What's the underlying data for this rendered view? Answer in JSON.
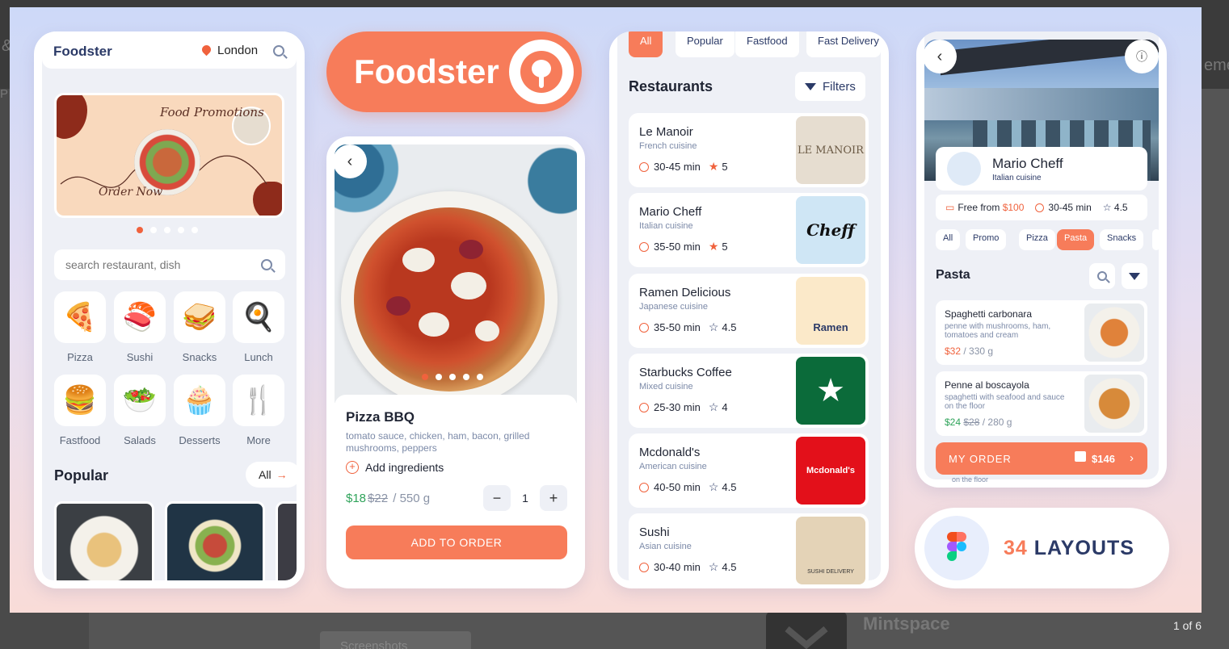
{
  "viewer": {
    "counter": "1 of 6"
  },
  "backdrop": {
    "title": "Mintspace",
    "button": "Screenshots",
    "frag_left": "&",
    "frag_left2": "P",
    "frag_right": "eme"
  },
  "brand": {
    "name": "Foodster",
    "accent": "#f77c5a"
  },
  "home": {
    "title": "Foodster",
    "location": "London",
    "banner_title": "Food Promotions",
    "banner_cta": "Order Now",
    "search_placeholder": "search restaurant, dish",
    "categories": [
      {
        "label": "Pizza",
        "icon": "pizza-icon",
        "glyph": "🍕"
      },
      {
        "label": "Sushi",
        "icon": "sushi-icon",
        "glyph": "🍣"
      },
      {
        "label": "Snacks",
        "icon": "snacks-icon",
        "glyph": "🥪"
      },
      {
        "label": "Lunch",
        "icon": "lunch-icon",
        "glyph": "🍳"
      },
      {
        "label": "Fastfood",
        "icon": "burger-icon",
        "glyph": "🍔"
      },
      {
        "label": "Salads",
        "icon": "salad-icon",
        "glyph": "🥗"
      },
      {
        "label": "Desserts",
        "icon": "cupcake-icon",
        "glyph": "🧁"
      },
      {
        "label": "More",
        "icon": "cutlery-icon",
        "glyph": "🍴"
      }
    ],
    "popular_title": "Popular",
    "popular_all": "All"
  },
  "detail": {
    "name": "Pizza BBQ",
    "description": "tomato sauce, chicken, ham, bacon, grilled mushrooms, peppers",
    "add_ingredients": "Add ingredients",
    "price": "$18",
    "old_price": "$22",
    "weight": "/ 550 g",
    "quantity": "1",
    "cta": "ADD TO ORDER"
  },
  "restaurants": {
    "tabs": [
      "All",
      "Popular",
      "Fastfood",
      "Fast Delivery"
    ],
    "title": "Restaurants",
    "filters": "Filters",
    "items": [
      {
        "name": "Le Manoir",
        "cuisine": "French cuisine",
        "time": "30-45 min",
        "rating": "5",
        "logo": "LE MANOIR",
        "logo_bg": "#e6ddd0",
        "logo_color": "#6b5a45",
        "star_filled": true
      },
      {
        "name": "Mario Cheff",
        "cuisine": "Italian cuisine",
        "time": "35-50 min",
        "rating": "5",
        "logo": "Cheff",
        "logo_bg": "#cfe6f5",
        "logo_color": "#111",
        "star_filled": true
      },
      {
        "name": "Ramen Delicious",
        "cuisine": "Japanese cuisine",
        "time": "35-50 min",
        "rating": "4.5",
        "logo": "Ramen",
        "logo_bg": "#fbe9c9",
        "logo_color": "#2b3a67",
        "star_filled": false
      },
      {
        "name": "Starbucks Coffee",
        "cuisine": "Mixed cuisine",
        "time": "25-30 min",
        "rating": "4",
        "logo": "★",
        "logo_bg": "#0b6b3a",
        "logo_color": "#fff",
        "star_filled": false
      },
      {
        "name": "Mcdonald's",
        "cuisine": "American cuisine",
        "time": "40-50 min",
        "rating": "4.5",
        "logo": "Mcdonald's",
        "logo_bg": "#e3101a",
        "logo_color": "#ffc72c",
        "star_filled": false
      },
      {
        "name": "Sushi",
        "cuisine": "Asian cuisine",
        "time": "30-40 min",
        "rating": "4.5",
        "logo": "SUSHI DELIVERY",
        "logo_bg": "#e4d3b7",
        "logo_color": "#333",
        "star_filled": false
      }
    ]
  },
  "menu": {
    "restaurant": "Mario Cheff",
    "cuisine": "Italian cuisine",
    "free_prefix": "Free from",
    "free_amount": "$100",
    "time": "30-45 min",
    "rating": "4.5",
    "tabs": [
      "All",
      "Promo",
      "Pizza",
      "Pasta",
      "Snacks"
    ],
    "active_tab": "Pasta",
    "section": "Pasta",
    "dishes": [
      {
        "name": "Spaghetti carbonara",
        "desc": "penne with mushrooms, ham, tomatoes and cream",
        "price": "$32",
        "old_price": "",
        "weight": "/ 330 g",
        "price_color": "#f0623d"
      },
      {
        "name": "Penne al boscayola",
        "desc": "spaghetti with seafood and sauce on the floor",
        "price": "$24",
        "old_price": "$28",
        "weight": "/ 280 g",
        "price_color": "#2fa35a"
      }
    ],
    "order_label": "MY ORDER",
    "order_total": "$146",
    "peek_text": "on the floor"
  },
  "promo": {
    "count": "34",
    "label": "LAYOUTS"
  }
}
